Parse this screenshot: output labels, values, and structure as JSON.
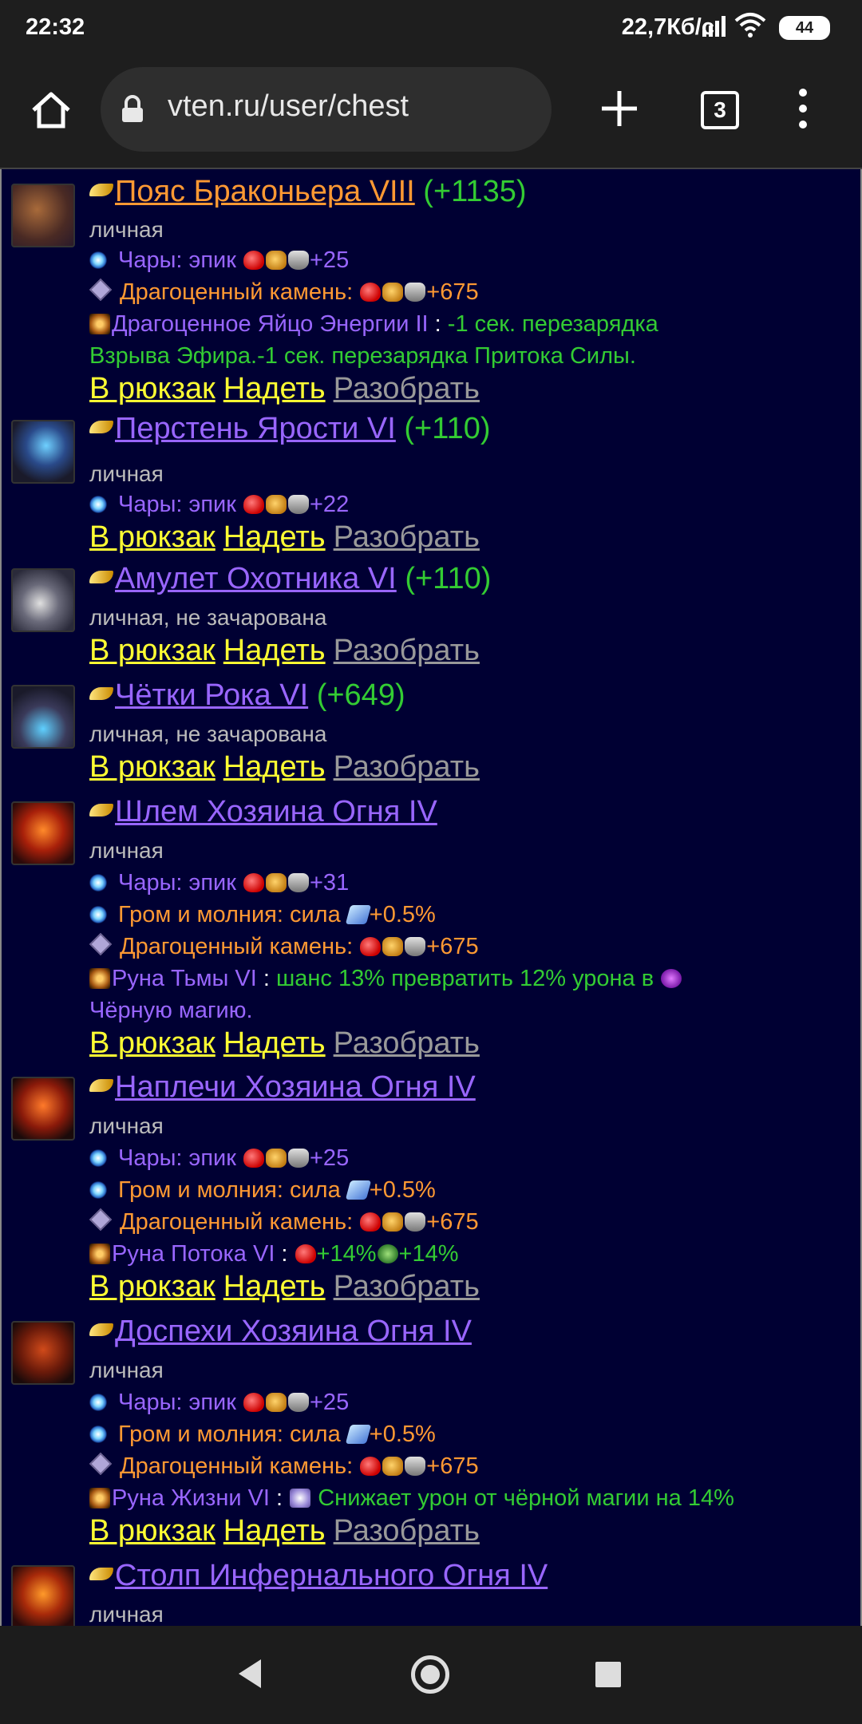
{
  "status_bar": {
    "time": "22:32",
    "network_speed": "22,7Кб/с",
    "battery": "44"
  },
  "browser": {
    "url": "vten.ru/user/chest",
    "tab_count": "3"
  },
  "actions": {
    "to_bag": "В рюкзак",
    "wear": "Надеть",
    "disassemble": "Разобрать"
  },
  "items": [
    {
      "name": "Пояс Браконьера VIII",
      "bonus": "(+1135)",
      "name_color": "#ff9933",
      "status": "личная",
      "enchant": {
        "label": "Чары: эпик",
        "value": "+25"
      },
      "gem": {
        "label": "Драгоценный камень:",
        "value": "+675"
      },
      "egg": {
        "name": "Драгоценное Яйцо Энергии II",
        "sep": " : ",
        "effect_line1": "-1 сек. перезарядка",
        "effect_line2": "Взрыва Эфира.-1 сек. перезарядка Притока Силы."
      }
    },
    {
      "name": "Перстень Ярости VI",
      "bonus": "(+110)",
      "name_color": "#9966ff",
      "status": "личная",
      "enchant": {
        "label": "Чары: эпик",
        "value": "+22"
      }
    },
    {
      "name": "Амулет Охотника VI",
      "bonus": "(+110)",
      "name_color": "#9966ff",
      "status": "личная, не зачарована"
    },
    {
      "name": "Чётки Рока VI",
      "bonus": "(+649)",
      "name_color": "#9966ff",
      "status": "личная, не зачарована"
    },
    {
      "name": "Шлем Хозяина Огня IV",
      "name_color": "#9966ff",
      "status": "личная",
      "enchant": {
        "label": "Чары: эпик",
        "value": "+31"
      },
      "thunder": {
        "label": "Гром и молния: сила",
        "value": "+0.5%"
      },
      "gem": {
        "label": "Драгоценный камень:",
        "value": "+675"
      },
      "rune": {
        "name": "Руна Тьмы VI",
        "sep": " : ",
        "effect_line1": "шанс 13% превратить 12% урона в",
        "effect_line2": "Чёрную магию."
      }
    },
    {
      "name": "Наплечи Хозяина Огня IV",
      "name_color": "#9966ff",
      "status": "личная",
      "enchant": {
        "label": "Чары: эпик",
        "value": "+25"
      },
      "thunder": {
        "label": "Гром и молния: сила",
        "value": "+0.5%"
      },
      "gem": {
        "label": "Драгоценный камень:",
        "value": "+675"
      },
      "rune": {
        "name": "Руна Потока VI",
        "sep": " : ",
        "value1": "+14%",
        "value2": "+14%"
      }
    },
    {
      "name": "Доспехи Хозяина Огня IV",
      "name_color": "#9966ff",
      "status": "личная",
      "enchant": {
        "label": "Чары: эпик",
        "value": "+25"
      },
      "thunder": {
        "label": "Гром и молния: сила",
        "value": "+0.5%"
      },
      "gem": {
        "label": "Драгоценный камень:",
        "value": "+675"
      },
      "rune": {
        "name": "Руна Жизни VI",
        "sep": " : ",
        "effect_line1": "Снижает урон от чёрной магии на 14%"
      }
    },
    {
      "name": "Столп Инфернального Огня IV",
      "name_color": "#9966ff",
      "status": "личная"
    }
  ]
}
